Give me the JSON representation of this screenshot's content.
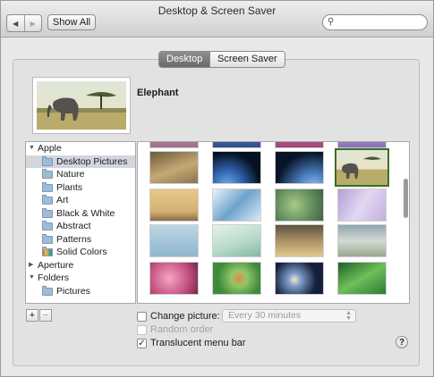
{
  "window": {
    "title": "Desktop & Screen Saver"
  },
  "toolbar": {
    "back_label": "◀",
    "forward_label": "▶",
    "show_all_label": "Show All",
    "search_placeholder": ""
  },
  "tabs": {
    "desktop": "Desktop",
    "screen_saver": "Screen Saver"
  },
  "preview": {
    "name": "Elephant"
  },
  "source_list": {
    "groups": [
      {
        "label": "Apple",
        "expanded": true,
        "items": [
          "Desktop Pictures",
          "Nature",
          "Plants",
          "Art",
          "Black & White",
          "Abstract",
          "Patterns",
          "Solid Colors"
        ]
      },
      {
        "label": "Aperture",
        "expanded": false,
        "items": []
      },
      {
        "label": "Folders",
        "expanded": true,
        "items": [
          "Pictures"
        ]
      }
    ],
    "selected": "Desktop Pictures"
  },
  "bottom": {
    "add_label": "+",
    "remove_label": "−",
    "change_picture_label": "Change picture:",
    "change_picture_checked": false,
    "interval_value": "Every 30 minutes",
    "random_order_label": "Random order",
    "random_order_checked": false,
    "translucent_label": "Translucent menu bar",
    "translucent_checked": true,
    "help_label": "?"
  },
  "colors": {
    "selection_border": "#3c6e2a",
    "active_tab": "#7a7a7a"
  }
}
